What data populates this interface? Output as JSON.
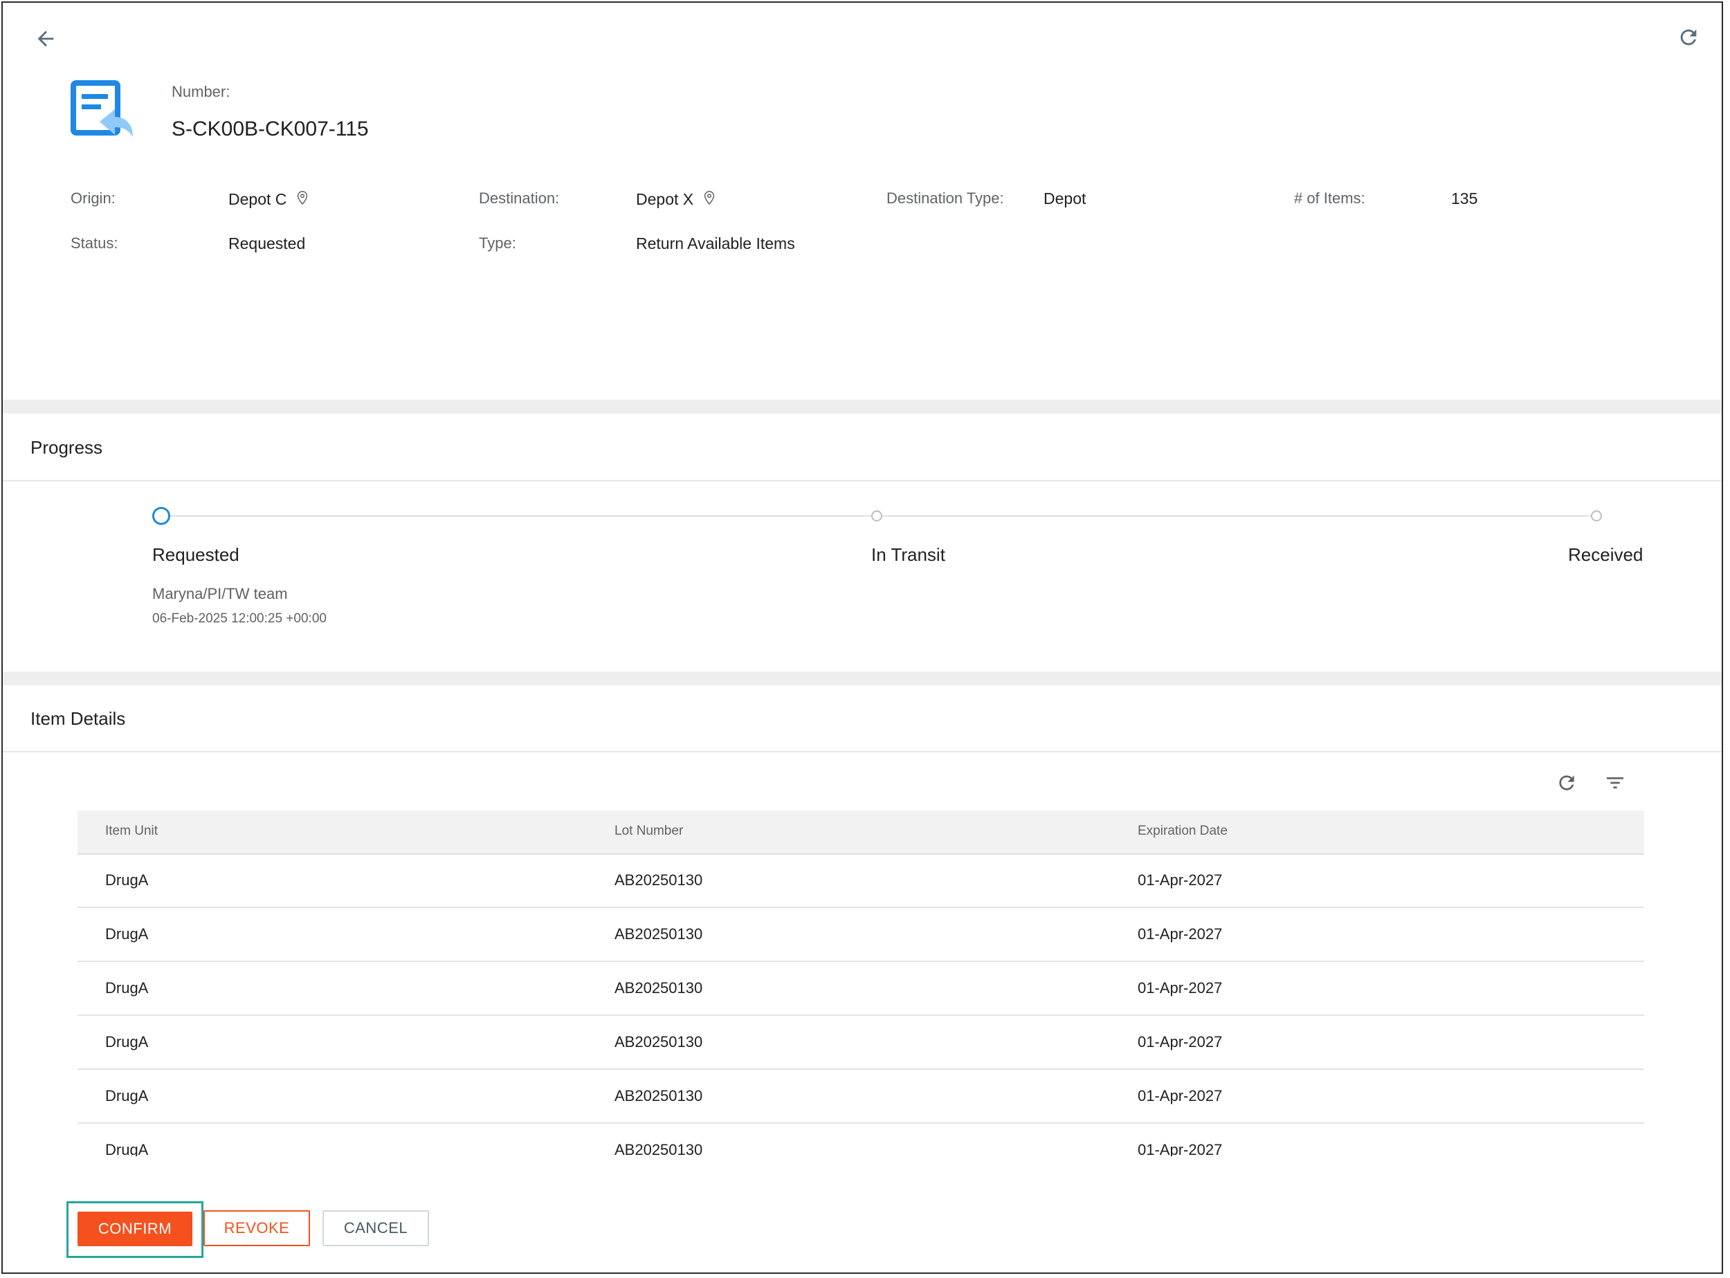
{
  "header": {
    "number_label": "Number:",
    "number_value": "S-CK00B-CK007-115"
  },
  "details": {
    "origin_label": "Origin:",
    "origin_value": "Depot C",
    "destination_label": "Destination:",
    "destination_value": "Depot X",
    "destination_type_label": "Destination Type:",
    "destination_type_value": "Depot",
    "items_label": "# of Items:",
    "items_value": "135",
    "status_label": "Status:",
    "status_value": "Requested",
    "type_label": "Type:",
    "type_value": "Return Available Items"
  },
  "progress": {
    "title": "Progress",
    "steps": [
      {
        "label": "Requested",
        "active": true
      },
      {
        "label": "In Transit",
        "active": false
      },
      {
        "label": "Received",
        "active": false
      }
    ],
    "requested_by": "Maryna/PI/TW team",
    "requested_at": "06-Feb-2025 12:00:25 +00:00"
  },
  "items": {
    "title": "Item Details",
    "columns": [
      "Item Unit",
      "Lot Number",
      "Expiration Date"
    ],
    "rows": [
      [
        "DrugA",
        "AB20250130",
        "01-Apr-2027"
      ],
      [
        "DrugA",
        "AB20250130",
        "01-Apr-2027"
      ],
      [
        "DrugA",
        "AB20250130",
        "01-Apr-2027"
      ],
      [
        "DrugA",
        "AB20250130",
        "01-Apr-2027"
      ],
      [
        "DrugA",
        "AB20250130",
        "01-Apr-2027"
      ],
      [
        "DrugA",
        "AB20250130",
        "01-Apr-2027"
      ]
    ]
  },
  "actions": {
    "confirm": "CONFIRM",
    "revoke": "REVOKE",
    "cancel": "CANCEL"
  },
  "colors": {
    "accent_blue": "#1e88e5",
    "confirm_orange": "#f4511e",
    "highlight_teal": "#26a69a"
  }
}
